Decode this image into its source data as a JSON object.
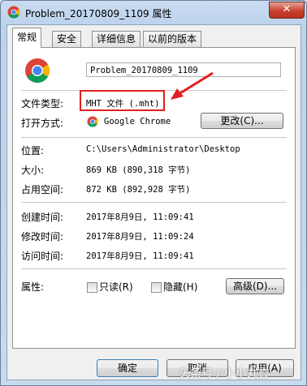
{
  "window": {
    "title": "Problem_20170809_1109 属性",
    "close_label": "✕"
  },
  "tabs": [
    "常规",
    "安全",
    "详细信息",
    "以前的版本"
  ],
  "file": {
    "name": "Problem_20170809_1109",
    "type_label": "文件类型:",
    "type_value": "MHT 文件 (.mht)",
    "opens_with_label": "打开方式:",
    "opens_with_value": "Google Chrome",
    "change_button": "更改(C)..."
  },
  "location": {
    "label": "位置:",
    "value": "C:\\Users\\Administrator\\Desktop"
  },
  "size": {
    "label": "大小:",
    "value": "869 KB (890,318 字节)"
  },
  "size_on_disk": {
    "label": "占用空间:",
    "value": "872 KB (892,928 字节)"
  },
  "created": {
    "label": "创建时间:",
    "value": "2017年8月9日, 11:09:41"
  },
  "modified": {
    "label": "修改时间:",
    "value": "2017年8月9日, 11:09:24"
  },
  "accessed": {
    "label": "访问时间:",
    "value": "2017年8月9日, 11:09:41"
  },
  "attributes": {
    "label": "属性:",
    "readonly_label": "只读(R)",
    "hidden_label": "隐藏(H)",
    "advanced_button": "高级(D)..."
  },
  "footer": {
    "ok": "确定",
    "cancel": "取消",
    "apply": "应用(A)"
  },
  "watermark": "头条号 / 小小丸言",
  "colors": {
    "highlight": "#e02020",
    "arrow": "#e02020"
  },
  "icons": [
    "chrome-icon",
    "close-icon",
    "arrow-annotation"
  ]
}
